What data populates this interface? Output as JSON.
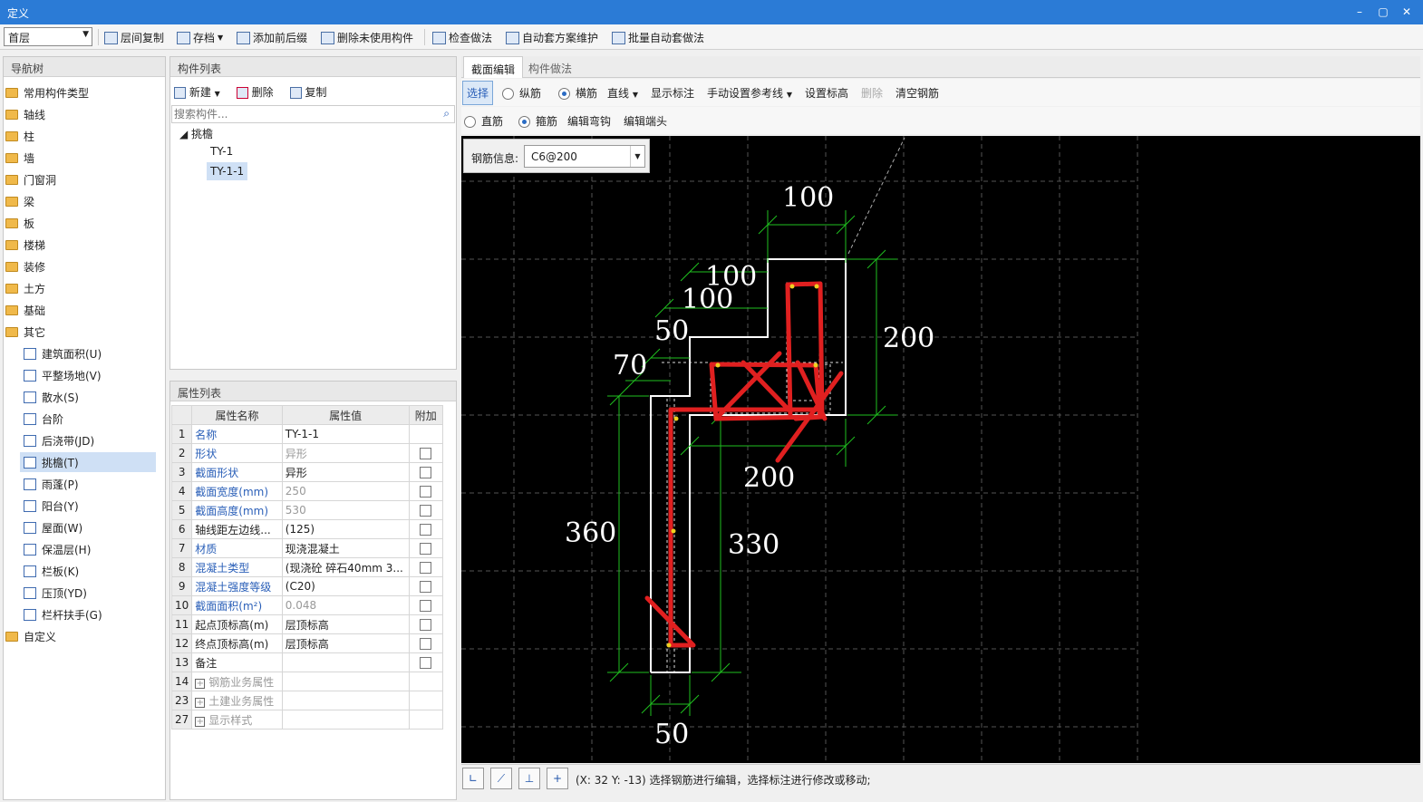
{
  "window": {
    "title": "定义"
  },
  "toolbar": {
    "floor": "首层",
    "buttons": [
      "层间复制",
      "存档",
      "添加前后缀",
      "删除未使用构件",
      "检查做法",
      "自动套方案维护",
      "批量自动套做法"
    ]
  },
  "nav": {
    "title": "导航树",
    "groups": [
      "常用构件类型",
      "轴线",
      "柱",
      "墙",
      "门窗洞",
      "梁",
      "板",
      "楼梯",
      "装修",
      "土方",
      "基础",
      "其它"
    ],
    "others": [
      "建筑面积(U)",
      "平整场地(V)",
      "散水(S)",
      "台阶",
      "后浇带(JD)",
      "挑檐(T)",
      "雨蓬(P)",
      "阳台(Y)",
      "屋面(W)",
      "保温层(H)",
      "栏板(K)",
      "压顶(YD)",
      "栏杆扶手(G)"
    ],
    "custom": "自定义"
  },
  "components": {
    "title": "构件列表",
    "actions": [
      "新建",
      "删除",
      "复制"
    ],
    "search_placeholder": "搜索构件...",
    "tree_root": "挑檐",
    "items": [
      "TY-1",
      "TY-1-1"
    ]
  },
  "properties": {
    "title": "属性列表",
    "headers": [
      "属性名称",
      "属性值",
      "附加"
    ],
    "rows": [
      {
        "n": "1",
        "name": "名称",
        "value": "TY-1-1",
        "blue": true,
        "gray": false,
        "cb": false
      },
      {
        "n": "2",
        "name": "形状",
        "value": "异形",
        "blue": true,
        "gray": true,
        "cb": true
      },
      {
        "n": "3",
        "name": "截面形状",
        "value": "异形",
        "blue": true,
        "gray": false,
        "cb": true
      },
      {
        "n": "4",
        "name": "截面宽度(mm)",
        "value": "250",
        "blue": true,
        "gray": true,
        "cb": true
      },
      {
        "n": "5",
        "name": "截面高度(mm)",
        "value": "530",
        "blue": true,
        "gray": true,
        "cb": true
      },
      {
        "n": "6",
        "name": "轴线距左边线...",
        "value": "(125)",
        "blue": false,
        "gray": false,
        "cb": true
      },
      {
        "n": "7",
        "name": "材质",
        "value": "现浇混凝土",
        "blue": true,
        "gray": false,
        "cb": true
      },
      {
        "n": "8",
        "name": "混凝土类型",
        "value": "(现浇砼 碎石40mm 3...",
        "blue": true,
        "gray": false,
        "cb": true
      },
      {
        "n": "9",
        "name": "混凝土强度等级",
        "value": "(C20)",
        "blue": true,
        "gray": false,
        "cb": true
      },
      {
        "n": "10",
        "name": "截面面积(m²)",
        "value": "0.048",
        "blue": true,
        "gray": true,
        "cb": true
      },
      {
        "n": "11",
        "name": "起点顶标高(m)",
        "value": "层顶标高",
        "blue": false,
        "gray": false,
        "cb": true
      },
      {
        "n": "12",
        "name": "终点顶标高(m)",
        "value": "层顶标高",
        "blue": false,
        "gray": false,
        "cb": true
      },
      {
        "n": "13",
        "name": "备注",
        "value": "",
        "blue": false,
        "gray": false,
        "cb": true
      }
    ],
    "groups": [
      {
        "n": "14",
        "name": "钢筋业务属性"
      },
      {
        "n": "23",
        "name": "土建业务属性"
      },
      {
        "n": "27",
        "name": "显示样式"
      }
    ]
  },
  "editor": {
    "tabs": [
      "截面编辑",
      "构件做法"
    ],
    "row1": {
      "select": "选择",
      "longitudinal": "纵筋",
      "transverse": "横筋",
      "line": "直线",
      "show_dim": "显示标注",
      "ref_line": "手动设置参考线",
      "set_elev": "设置标高",
      "delete": "删除",
      "clear": "清空钢筋"
    },
    "row2": {
      "straight": "直筋",
      "stirrup": "箍筋",
      "edit_hook": "编辑弯钩",
      "edit_end": "编辑端头"
    },
    "rebar_label": "钢筋信息:",
    "rebar_value": "C6@200",
    "dims": [
      "100",
      "100",
      "100",
      "50",
      "70",
      "200",
      "200",
      "360",
      "330",
      "50"
    ]
  },
  "status": {
    "text": "(X: 32 Y: -13)  选择钢筋进行编辑，选择标注进行修改或移动;"
  }
}
